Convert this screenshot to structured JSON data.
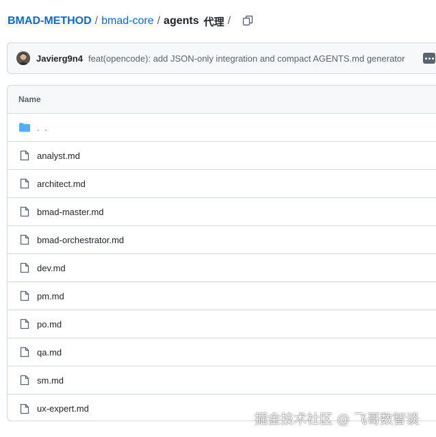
{
  "breadcrumb": {
    "repo": "BMAD-METHOD",
    "folder": "bmad-core",
    "current": "agents",
    "extra_label": "代理",
    "separator": "/"
  },
  "commit": {
    "author": "Javierg9n4",
    "message": "feat(opencode): add JSON-only integration and compact AGENTS.md generator"
  },
  "table": {
    "header": "Name",
    "parent_label": ". .",
    "files": [
      "analyst.md",
      "architect.md",
      "bmad-master.md",
      "bmad-orchestrator.md",
      "dev.md",
      "pm.md",
      "po.md",
      "qa.md",
      "sm.md",
      "ux-expert.md"
    ]
  },
  "watermark": "掘金技术社区 @ 飞哥数智谈",
  "colors": {
    "link": "#0969da",
    "folder": "#54aeff",
    "border": "#d1d9e0",
    "muted": "#59636e"
  },
  "icons": {
    "folder": "folder-icon",
    "file": "file-icon",
    "copy": "copy-icon",
    "more": "kebab-icon"
  }
}
